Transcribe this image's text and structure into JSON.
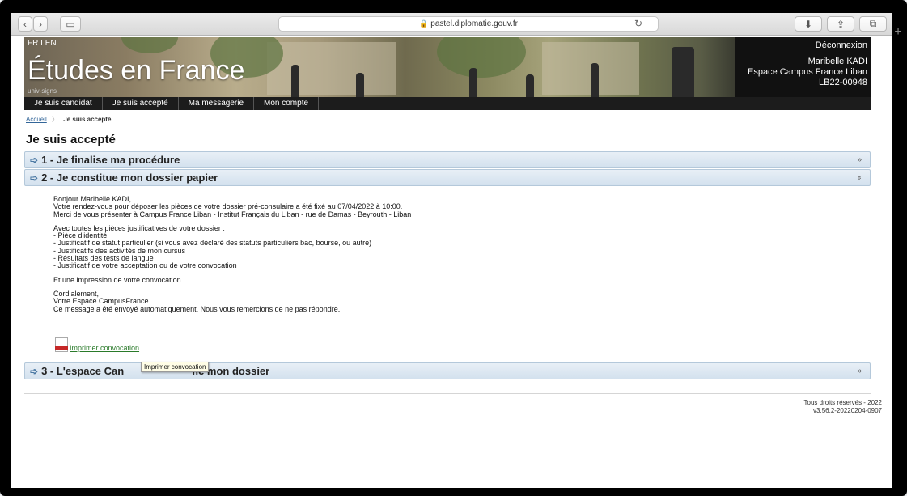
{
  "browser": {
    "url": "pastel.diplomatie.gouv.fr"
  },
  "header": {
    "lang_fr": "FR",
    "lang_sep": "I",
    "lang_en": "EN",
    "site_title": "Études en France",
    "univ_tag": "univ-signs",
    "logout": "Déconnexion",
    "user_name": "Maribelle KADI",
    "user_space": "Espace Campus France Liban",
    "user_id": "LB22-00948"
  },
  "nav": {
    "items": [
      "Je suis candidat",
      "Je suis accepté",
      "Ma messagerie",
      "Mon compte"
    ]
  },
  "breadcrumb": {
    "home": "Accueil",
    "current": "Je suis accepté"
  },
  "page": {
    "title": "Je suis accepté"
  },
  "sections": [
    {
      "label": "1 - Je finalise ma procédure",
      "chevron": "»"
    },
    {
      "label": "2 - Je constitue mon dossier papier",
      "chevron": "»"
    },
    {
      "label": "3 - L'espace Can",
      "label_tail": "fie mon dossier",
      "chevron": "»"
    }
  ],
  "message": {
    "greeting": "Bonjour Maribelle KADI,",
    "line_rdv": "Votre rendez-vous pour déposer les pièces de votre dossier pré-consulaire a été fixé au 07/04/2022 à 10:00.",
    "line_place": "Merci de vous présenter à Campus France Liban - Institut Français du Liban - rue de Damas - Beyrouth - Liban",
    "list_intro": "Avec toutes les pièces justificatives de votre dossier :",
    "list_items": [
      "- Pièce d'identité",
      "- Justificatif de statut particulier (si vous avez déclaré des statuts particuliers bac, bourse, ou autre)",
      "- Justificatifs des activités de mon cursus",
      "- Résultats des tests de langue",
      "- Justificatif de votre acceptation ou de votre convocation"
    ],
    "print_note": "Et une impression de votre convocation.",
    "closing": "Cordialement,",
    "signature": "Votre Espace CampusFrance",
    "auto_note": "Ce message a été envoyé automatiquement. Nous vous remercions de ne pas répondre."
  },
  "print_link": {
    "label": "Imprimer convocation",
    "tooltip": "Imprimer convocation"
  },
  "footer": {
    "rights": "Tous droits réservés - 2022",
    "version": "v3.56.2-20220204-0907"
  }
}
